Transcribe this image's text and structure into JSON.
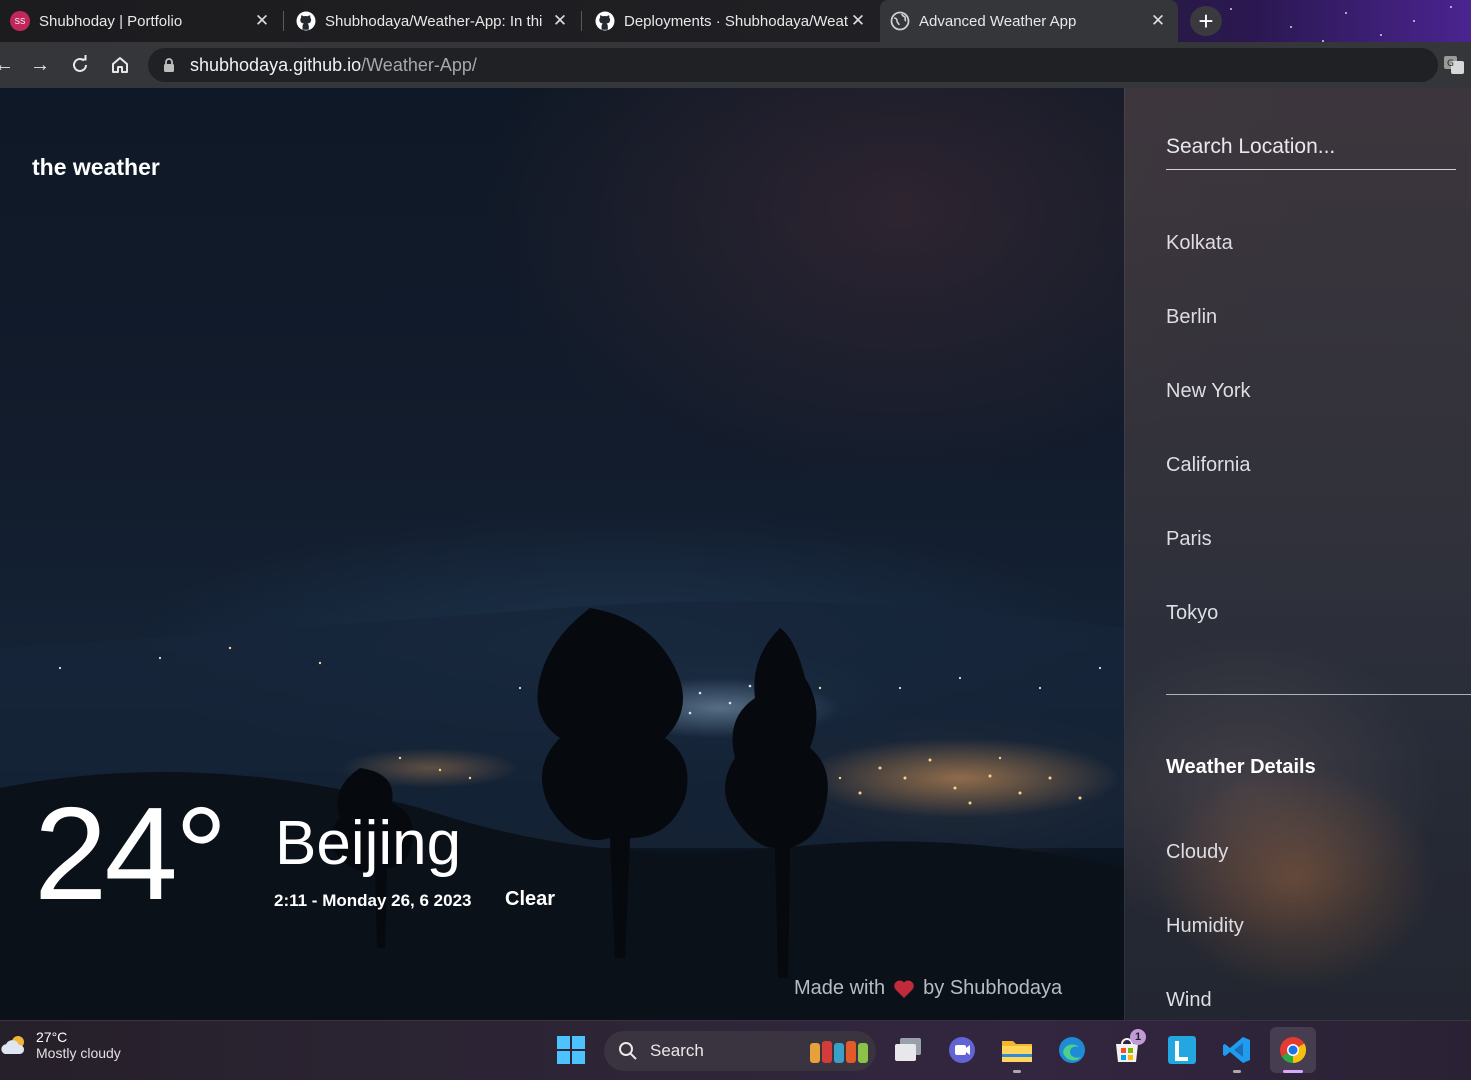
{
  "browser": {
    "tabs": [
      {
        "title": "Shubhoday | Portfolio",
        "active": false
      },
      {
        "title": "Shubhodaya/Weather-App: In thi",
        "active": false
      },
      {
        "title": "Deployments · Shubhodaya/Weat",
        "active": false
      },
      {
        "title": "Advanced Weather App",
        "active": true
      }
    ],
    "url_host": "shubhodaya.github.io",
    "url_path": "/Weather-App/"
  },
  "app": {
    "brand": "the weather",
    "temperature": "24°",
    "city": "Beijing",
    "datetime": "2:11 - Monday 26, 6 2023",
    "condition": "Clear",
    "footer_prefix": "Made with",
    "footer_suffix": "by Shubhodaya",
    "search_placeholder": "Search Location...",
    "locations": [
      "Kolkata",
      "Berlin",
      "New York",
      "California",
      "Paris",
      "Tokyo"
    ],
    "details_title": "Weather Details",
    "details": [
      "Cloudy",
      "Humidity",
      "Wind"
    ]
  },
  "taskbar": {
    "weather_temp": "27°C",
    "weather_desc": "Mostly cloudy",
    "search_label": "Search",
    "store_badge": "1"
  },
  "colors": {
    "heart": "#d03040",
    "moon": "#1e6ee8",
    "panel": "#3a373e"
  }
}
